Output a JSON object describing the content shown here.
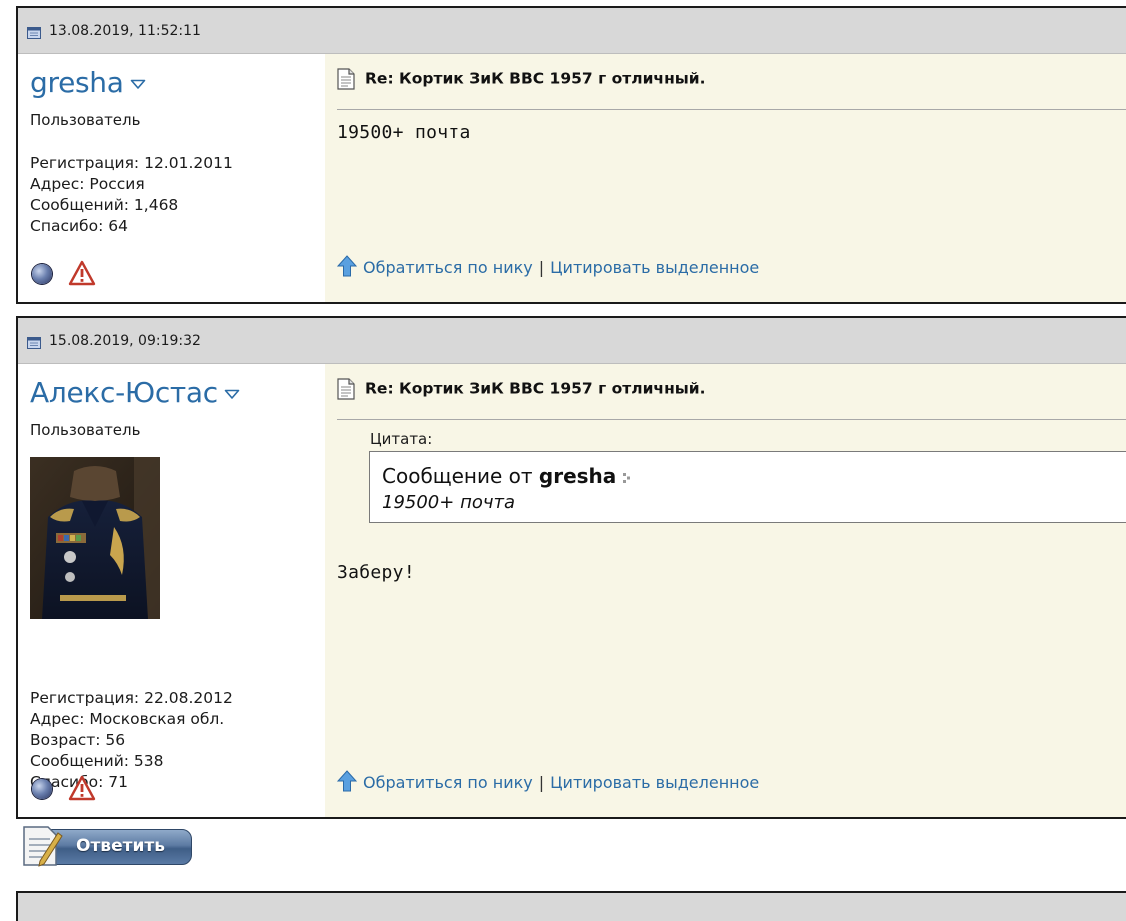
{
  "posts": [
    {
      "date": "13.08.2019, 11:52:11",
      "username": "gresha",
      "role": "Пользователь",
      "stats": [
        "Регистрация: 12.01.2011",
        "Адрес: Россия",
        "Сообщений: 1,468",
        "Спасибо: 64"
      ],
      "title": "Re: Кортик ЗиК ВВС 1957 г отличный.",
      "text": "19500+ почта",
      "actions": {
        "address_nick": "Обратиться по нику",
        "separator": "|",
        "quote_selected": "Цитировать выделенное"
      }
    },
    {
      "date": "15.08.2019, 09:19:32",
      "username": "Алекс-Юстас",
      "role": "Пользователь",
      "stats": [
        "Регистрация: 22.08.2012",
        "Адрес: Московская обл.",
        "Возраст: 56",
        "Сообщений: 538",
        "Спасибо: 71"
      ],
      "title": "Re: Кортик ЗиК ВВС 1957 г отличный.",
      "quote": {
        "label": "Цитата:",
        "from_prefix": "Сообщение от",
        "from_user": "gresha",
        "text": "19500+ почта"
      },
      "text": "Заберу!",
      "actions": {
        "address_nick": "Обратиться по нику",
        "separator": "|",
        "quote_selected": "Цитировать выделенное"
      }
    }
  ],
  "reply_button": {
    "label": "Ответить"
  },
  "colors": {
    "link": "#2b6ca6",
    "header_bg": "#d8d8d8",
    "message_bg": "#f8f6e6",
    "border": "#1a1a1a"
  },
  "icons": {
    "date": "post-date-icon",
    "menu": "user-menu-caret-icon",
    "online": "offline-status-icon",
    "report": "report-warning-icon",
    "doc": "post-document-icon",
    "up": "up-arrow-icon",
    "goto": "goto-post-icon"
  }
}
